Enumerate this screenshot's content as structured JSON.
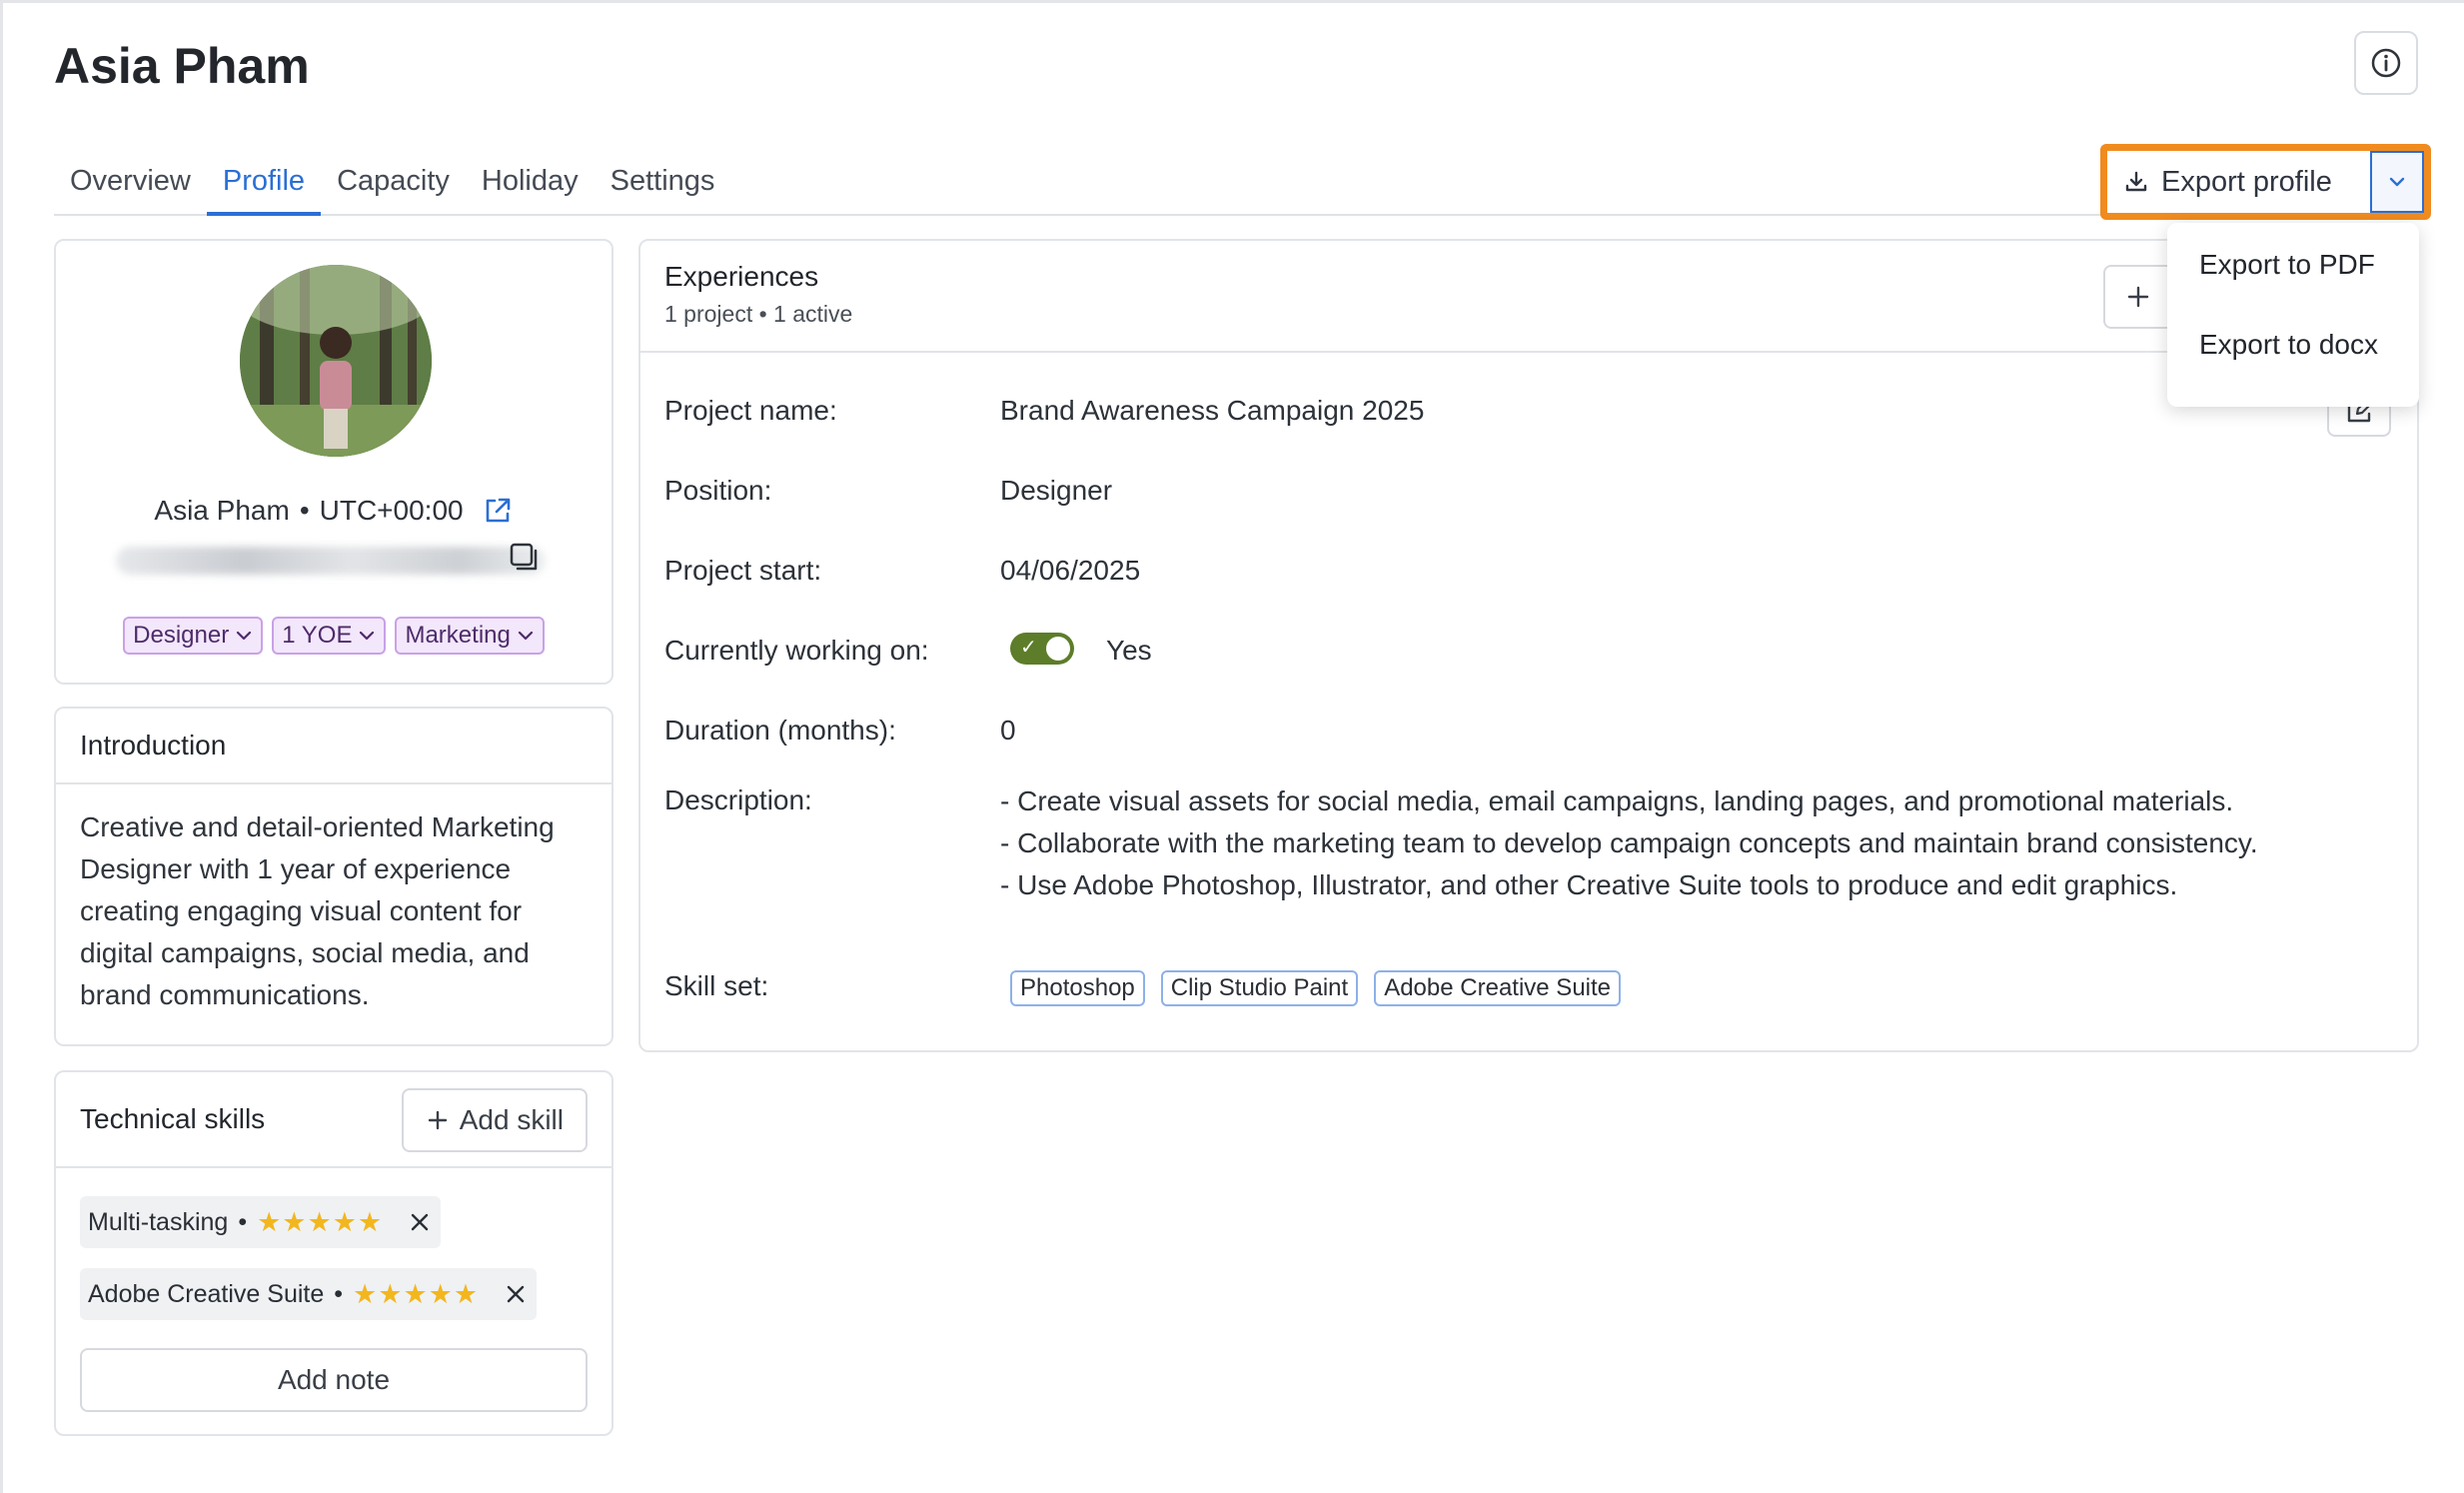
{
  "header": {
    "title": "Asia Pham"
  },
  "tabs": [
    {
      "label": "Overview",
      "active": false
    },
    {
      "label": "Profile",
      "active": true
    },
    {
      "label": "Capacity",
      "active": false
    },
    {
      "label": "Holiday",
      "active": false
    },
    {
      "label": "Settings",
      "active": false
    }
  ],
  "export": {
    "button_label": "Export profile",
    "menu": [
      "Export to PDF",
      "Export to docx"
    ]
  },
  "profile": {
    "name": "Asia Pham",
    "separator": "•",
    "timezone": "UTC+00:00",
    "tags": [
      "Designer",
      "1 YOE",
      "Marketing"
    ]
  },
  "introduction": {
    "title": "Introduction",
    "text": "Creative and detail-oriented Marketing Designer with 1 year of experience creating engaging visual content for digital campaigns, social media, and brand communications."
  },
  "technical_skills": {
    "title": "Technical skills",
    "add_label": "Add skill",
    "skills": [
      {
        "name": "Multi-tasking",
        "rating": 5,
        "stars": "★★★★★"
      },
      {
        "name": "Adobe Creative Suite",
        "rating": 5,
        "stars": "★★★★★"
      }
    ],
    "add_note_label": "Add note"
  },
  "experiences": {
    "title": "Experiences",
    "subtitle": "1 project • 1 active",
    "fields": {
      "project_name_label": "Project name:",
      "project_name": "Brand Awareness Campaign 2025",
      "position_label": "Position:",
      "position": "Designer",
      "project_start_label": "Project start:",
      "project_start": "04/06/2025",
      "working_label": "Currently working on:",
      "working": "Yes",
      "duration_label": "Duration (months):",
      "duration": "0",
      "description_label": "Description:",
      "description": [
        "- Create visual assets for social media, email campaigns, landing pages, and promotional materials.",
        "- Collaborate with the marketing team to develop campaign concepts and maintain brand consistency.",
        "- Use Adobe Photoshop, Illustrator, and other Creative Suite tools to produce and edit graphics."
      ],
      "skill_set_label": "Skill set:",
      "skill_set": [
        "Photoshop",
        "Clip Studio Paint",
        "Adobe Creative Suite"
      ]
    }
  },
  "colors": {
    "accent": "#2b6fd4",
    "highlight": "#f08b1f",
    "toggle_on": "#5d7d2a",
    "tag_purple_bg": "#f3e7fb",
    "star": "#f2b61f"
  }
}
